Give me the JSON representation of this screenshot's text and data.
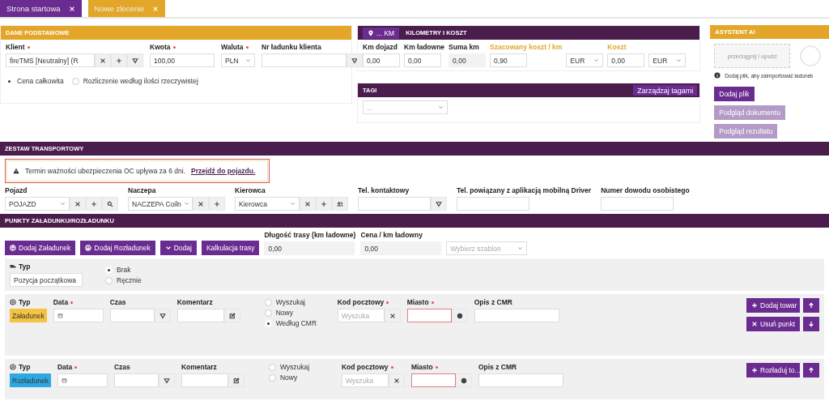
{
  "tabs": [
    {
      "label": "Strona startowa",
      "selected": false
    },
    {
      "label": "Nowe zlecenie",
      "selected": true
    }
  ],
  "basic": {
    "title": "DANE PODSTAWOWE",
    "client": {
      "label": "Klient",
      "required": true,
      "value": "fireTMS [Neutralny] (R"
    },
    "amount": {
      "label": "Kwota",
      "required": true,
      "value": "100,00"
    },
    "currency": {
      "label": "Waluta",
      "required": true,
      "value": "PLN"
    },
    "cargo_no": {
      "label": "Nr ładunku klienta",
      "required": false
    },
    "price_modes": [
      {
        "label": "Cena całkowita",
        "selected": true
      },
      {
        "label": "Rozliczenie według ilości rzeczywistej",
        "selected": false
      }
    ]
  },
  "km": {
    "badge": "... KM",
    "title": "KILOMETRY I KOSZT",
    "fields": [
      {
        "kind": "input",
        "label": "Km dojazd",
        "highlight": false,
        "value": "0,00"
      },
      {
        "kind": "input",
        "label": "Km ładowne",
        "highlight": false,
        "value": "0,00"
      },
      {
        "kind": "readonly",
        "label": "Suma km",
        "highlight": false,
        "value": "0,00"
      },
      {
        "kind": "input",
        "label": "Szacowany koszt / km",
        "highlight": true,
        "value": "0,90"
      },
      {
        "kind": "select",
        "value": "EUR"
      },
      {
        "kind": "input",
        "label": "Koszt",
        "highlight": true,
        "value": "0,00"
      },
      {
        "kind": "select",
        "value": "EUR"
      }
    ]
  },
  "tags": {
    "title": "TAGI",
    "button": "Zarządzaj tagami",
    "placeholder": "..."
  },
  "ai": {
    "title": "ASYSTENT AI",
    "dropzone": "przeciągnij i upuść",
    "hint": "Dodaj plik, aby zaimportować ładunek",
    "buttons": [
      {
        "label": "Dodaj plik",
        "disabled": false
      },
      {
        "label": "Podgląd dokumentu",
        "disabled": true
      },
      {
        "label": "Podgląd rezultatu",
        "disabled": true
      }
    ]
  },
  "transport": {
    "title": "ZESTAW TRANSPORTOWY",
    "warning": {
      "text": "Termin ważności ubezpieczenia OC upływa za 6 dni.",
      "link": "Przejdź do pojazdu."
    },
    "fields": [
      {
        "kind": "select",
        "label": "Pojazd",
        "value": "POJAZD"
      },
      {
        "kind": "select",
        "label": "Naczepa",
        "value": "NACZEPA Coiln"
      },
      {
        "kind": "select",
        "label": "Kierowca",
        "value": "Kierowca"
      },
      {
        "kind": "input",
        "label": "Tel. kontaktowy"
      },
      {
        "kind": "input",
        "label": "Tel. powiązany z aplikacją mobilną Driver"
      },
      {
        "kind": "input",
        "label": "Numer dowodu osobistego"
      }
    ]
  },
  "points": {
    "title": "PUNKTY ZAŁADUNKU/ROZŁADUNKU",
    "buttons": [
      "Dodaj Załadunek",
      "Dodaj Rozładunek",
      "Dodaj",
      "Kalkulacja trasy"
    ],
    "route_length": {
      "label": "Długość trasy (km ładowne)",
      "value": "0,00"
    },
    "price_km": {
      "label": "Cena / km ładowny",
      "value": "0,00"
    },
    "template": {
      "placeholder": "Wybierz szablon"
    },
    "start": {
      "type_label": "Typ",
      "value": "Pozycja początkowa",
      "options": [
        {
          "label": "Brak",
          "selected": true
        },
        {
          "label": "Ręcznie",
          "selected": false
        }
      ]
    },
    "items": [
      {
        "type_label": "Typ",
        "type": "Załadunek",
        "color": "#f5c242",
        "date_label": "Data",
        "date_required": true,
        "time_label": "Czas",
        "comment_label": "Komentarz",
        "sources": [
          {
            "label": "Wyszukaj",
            "selected": false
          },
          {
            "label": "Nowy",
            "selected": false
          },
          {
            "label": "Według CMR",
            "selected": true
          }
        ],
        "postal_label": "Kod pocztowy",
        "postal_required": true,
        "postal_placeholder": "Wyszuka",
        "city_label": "Miasto",
        "city_required": true,
        "cmr_label": "Opis z CMR",
        "buttons": [
          "Dodaj towar",
          "Usuń punkt"
        ]
      },
      {
        "type_label": "Typ",
        "type": "Rozładunek",
        "color": "#2ea8e0",
        "date_label": "Data",
        "date_required": true,
        "time_label": "Czas",
        "comment_label": "Komentarz",
        "sources": [
          {
            "label": "Wyszukaj",
            "selected": false
          },
          {
            "label": "Nowy",
            "selected": false
          }
        ],
        "postal_label": "Kod pocztowy",
        "postal_required": true,
        "postal_placeholder": "Wyszuka",
        "city_label": "Miasto",
        "city_required": true,
        "cmr_label": "Opis z CMR",
        "buttons": [
          "Rozładuj to..."
        ]
      }
    ]
  }
}
